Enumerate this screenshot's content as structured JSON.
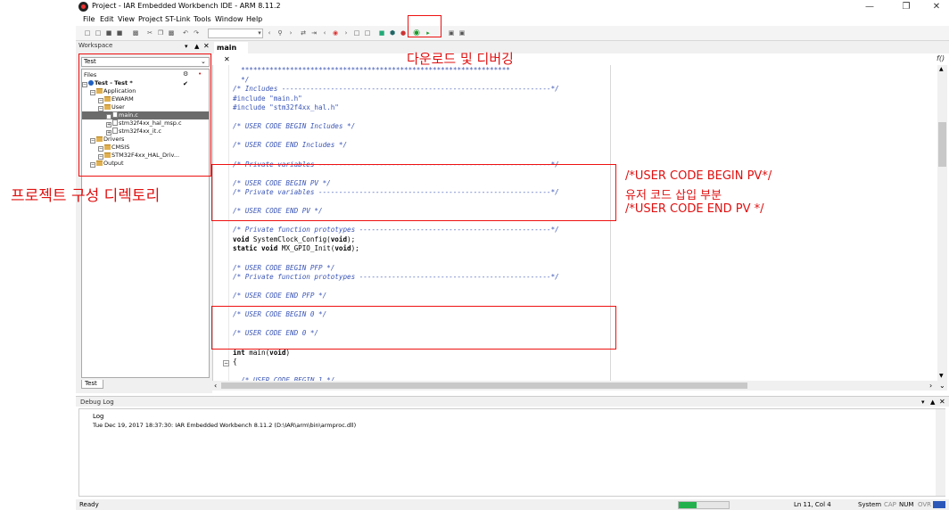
{
  "window": {
    "title": "Project - IAR Embedded Workbench IDE - ARM 8.11.2"
  },
  "menu": [
    "File",
    "Edit",
    "View",
    "Project",
    "ST-Link",
    "Tools",
    "Window",
    "Help"
  ],
  "workspace": {
    "title": "Workspace",
    "config": "Test",
    "files_label": "Files",
    "tab": "Test",
    "tree": [
      {
        "label": "Test - Test *",
        "kind": "proj",
        "depth": 0
      },
      {
        "label": "Application",
        "kind": "folder",
        "depth": 1
      },
      {
        "label": "EWARM",
        "kind": "folder",
        "depth": 2
      },
      {
        "label": "User",
        "kind": "folder",
        "depth": 2
      },
      {
        "label": "main.c",
        "kind": "file",
        "depth": 3,
        "selected": true
      },
      {
        "label": "stm32f4xx_hal_msp.c",
        "kind": "file",
        "depth": 3
      },
      {
        "label": "stm32f4xx_it.c",
        "kind": "file",
        "depth": 3
      },
      {
        "label": "Drivers",
        "kind": "folder",
        "depth": 1
      },
      {
        "label": "CMSIS",
        "kind": "folder",
        "depth": 2
      },
      {
        "label": "STM32F4xx_HAL_Driv...",
        "kind": "folder",
        "depth": 2
      },
      {
        "label": "Output",
        "kind": "folder",
        "depth": 1
      }
    ]
  },
  "editor": {
    "tab": "main",
    "fn_button": "f()",
    "lines": [
      {
        "t": "  ******************************************************************",
        "c": "cmt"
      },
      {
        "t": "  */",
        "c": "cmt"
      },
      {
        "t": "/* Includes ------------------------------------------------------------------*/",
        "c": "cmt"
      },
      {
        "t": "#include \"main.h\"",
        "c": "pre"
      },
      {
        "t": "#include \"stm32f4xx_hal.h\"",
        "c": "pre"
      },
      {
        "t": "",
        "c": ""
      },
      {
        "t": "/* USER CODE BEGIN Includes */",
        "c": "cmt"
      },
      {
        "t": "",
        "c": ""
      },
      {
        "t": "/* USER CODE END Includes */",
        "c": "cmt"
      },
      {
        "t": "",
        "c": ""
      },
      {
        "t": "/* Private variables ---------------------------------------------------------*/",
        "c": "cmt"
      },
      {
        "t": "",
        "c": ""
      },
      {
        "t": "/* USER CODE BEGIN PV */",
        "c": "cmt"
      },
      {
        "t": "/* Private variables ---------------------------------------------------------*/",
        "c": "cmt"
      },
      {
        "t": "",
        "c": ""
      },
      {
        "t": "/* USER CODE END PV */",
        "c": "cmt"
      },
      {
        "t": "",
        "c": ""
      },
      {
        "t": "/* Private function prototypes -----------------------------------------------*/",
        "c": "cmt"
      },
      {
        "t": "void SystemClock_Config(void);",
        "c": "kw"
      },
      {
        "t": "static void MX_GPIO_Init(void);",
        "c": "kw"
      },
      {
        "t": "",
        "c": ""
      },
      {
        "t": "/* USER CODE BEGIN PFP */",
        "c": "cmt"
      },
      {
        "t": "/* Private function prototypes -----------------------------------------------*/",
        "c": "cmt"
      },
      {
        "t": "",
        "c": ""
      },
      {
        "t": "/* USER CODE END PFP */",
        "c": "cmt"
      },
      {
        "t": "",
        "c": ""
      },
      {
        "t": "/* USER CODE BEGIN 0 */",
        "c": "cmt"
      },
      {
        "t": "",
        "c": ""
      },
      {
        "t": "/* USER CODE END 0 */",
        "c": "cmt"
      },
      {
        "t": "",
        "c": ""
      },
      {
        "t": "int main(void)",
        "c": "kw"
      },
      {
        "t": "{",
        "c": ""
      },
      {
        "t": "",
        "c": ""
      },
      {
        "t": "  /* USER CODE BEGIN 1 */",
        "c": "cmt"
      }
    ]
  },
  "debug_log": {
    "title": "Debug Log",
    "header": "Log",
    "entry": "Tue Dec 19, 2017 18:37:30: IAR Embedded Workbench 8.11.2 (D:\\IAR\\arm\\bin\\armproc.dll)"
  },
  "status": {
    "ready": "Ready",
    "position": "Ln 11, Col 4",
    "system": "System",
    "cap": "CAP",
    "num": "NUM",
    "ovr": "OVR"
  },
  "annotations": {
    "download_debug": "다운로드 및 디버깅",
    "project_tree": "프로젝트 구성 디렉토리",
    "pv_line1": "/*USER CODE BEGIN PV*/",
    "pv_line2": "유저 코드 삽입 부분",
    "pv_line3": "/*USER CODE END PV */"
  },
  "colors": {
    "annotation": "#e01010",
    "comment": "#3a55b5",
    "progress": "#22b14c"
  }
}
